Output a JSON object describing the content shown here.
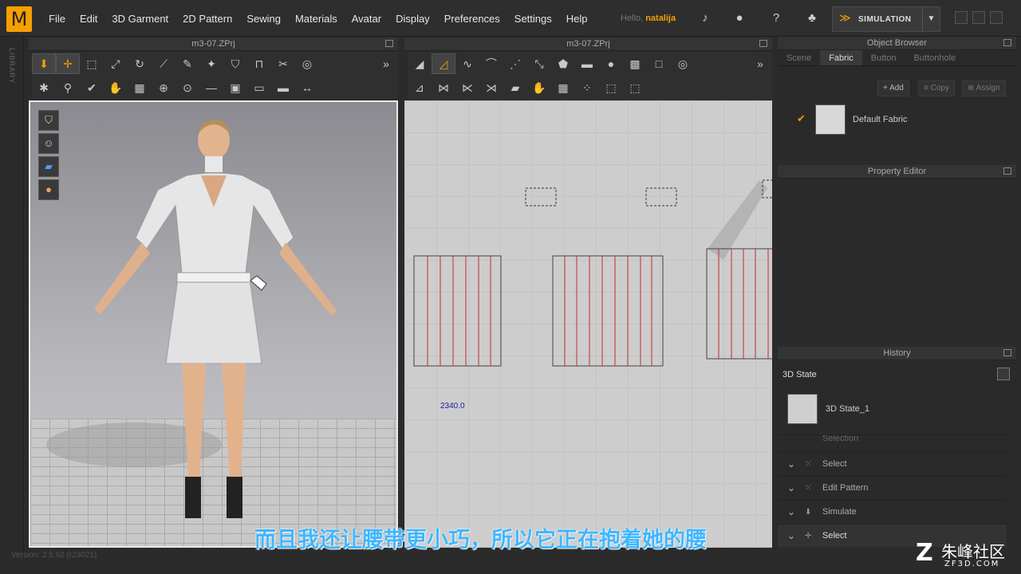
{
  "menubar": {
    "logo": "M",
    "items": [
      "File",
      "Edit",
      "3D Garment",
      "2D Pattern",
      "Sewing",
      "Materials",
      "Avatar",
      "Display",
      "Preferences",
      "Settings",
      "Help"
    ],
    "hello_prefix": "Hello,",
    "user": "natalija",
    "sim_label": "SIMULATION"
  },
  "sidebar": {
    "label": "LIBRARY"
  },
  "pane3d": {
    "title": "m3-07.ZPrj"
  },
  "pane2d": {
    "title": "m3-07.ZPrj",
    "measurement": "2340.0"
  },
  "object_browser": {
    "title": "Object Browser",
    "tabs": [
      "Scene",
      "Fabric",
      "Button",
      "Buttonhole"
    ],
    "active_tab": "Fabric",
    "buttons": {
      "add": "Add",
      "copy": "Copy",
      "assign": "Assign"
    },
    "fabric_name": "Default Fabric"
  },
  "property_editor": {
    "title": "Property Editor"
  },
  "history": {
    "title": "History",
    "state_title": "3D State",
    "state_item": "3D State_1",
    "rows": [
      "Selection",
      "Select",
      "Edit Pattern",
      "Simulate",
      "Select"
    ]
  },
  "subtitle": "而且我还让腰带更小巧，所以它正在抱着她的腰",
  "version": "Version: 2.5.92     (r23021)",
  "watermark": {
    "brand": "朱峰社区",
    "url": "ZF3D.COM"
  },
  "colors": {
    "accent": "#f0a000",
    "subtitle": "#3fb6ff"
  }
}
